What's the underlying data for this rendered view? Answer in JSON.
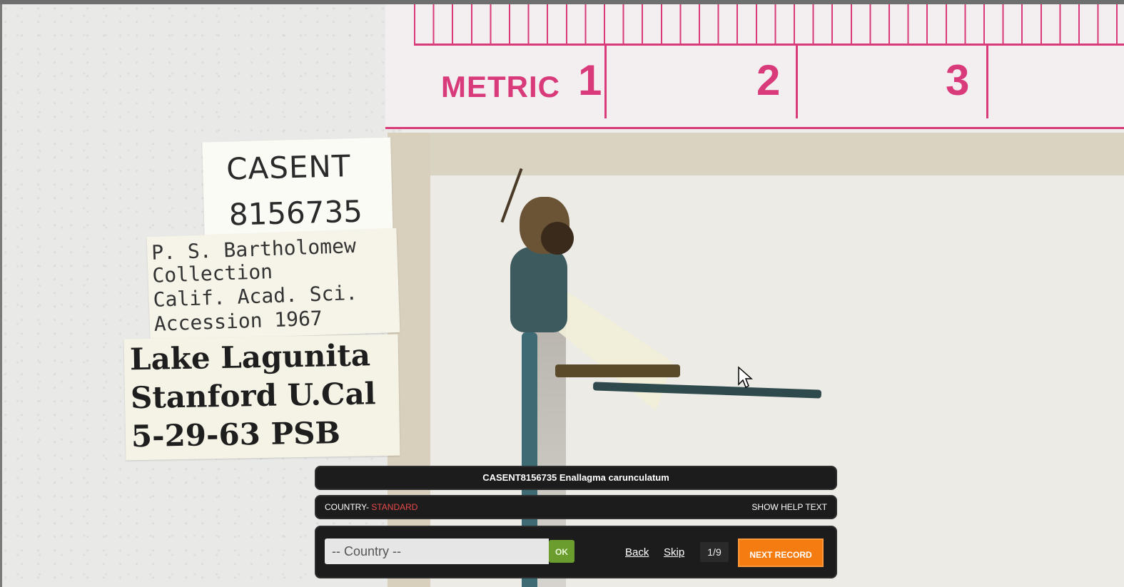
{
  "ruler": {
    "word": "METRIC",
    "numbers": [
      "1",
      "2",
      "3"
    ]
  },
  "labels": {
    "casent": [
      "CASENT",
      "8156735"
    ],
    "collection": [
      "P. S. Bartholomew",
      "Collection",
      "Calif. Acad. Sci.",
      "Accession 1967"
    ],
    "locality": [
      "Lake Lagunita",
      "Stanford U.Cal",
      "5-29-63 PSB"
    ]
  },
  "record": {
    "title": "CASENT8156735 Enallagma carunculatum"
  },
  "field": {
    "name": "COUNTRY- ",
    "standard": "STANDARD",
    "help": "SHOW HELP TEXT"
  },
  "controls": {
    "country_value": "-- Country --",
    "ok_label": "OK",
    "back_label": "Back",
    "skip_label": "Skip",
    "page": "1/9",
    "next_label": "NEXT RECORD"
  },
  "colors": {
    "ruler": "#d83a7a",
    "next": "#f57c11",
    "ok": "#6a9d2e",
    "standard": "#e84a4a"
  }
}
